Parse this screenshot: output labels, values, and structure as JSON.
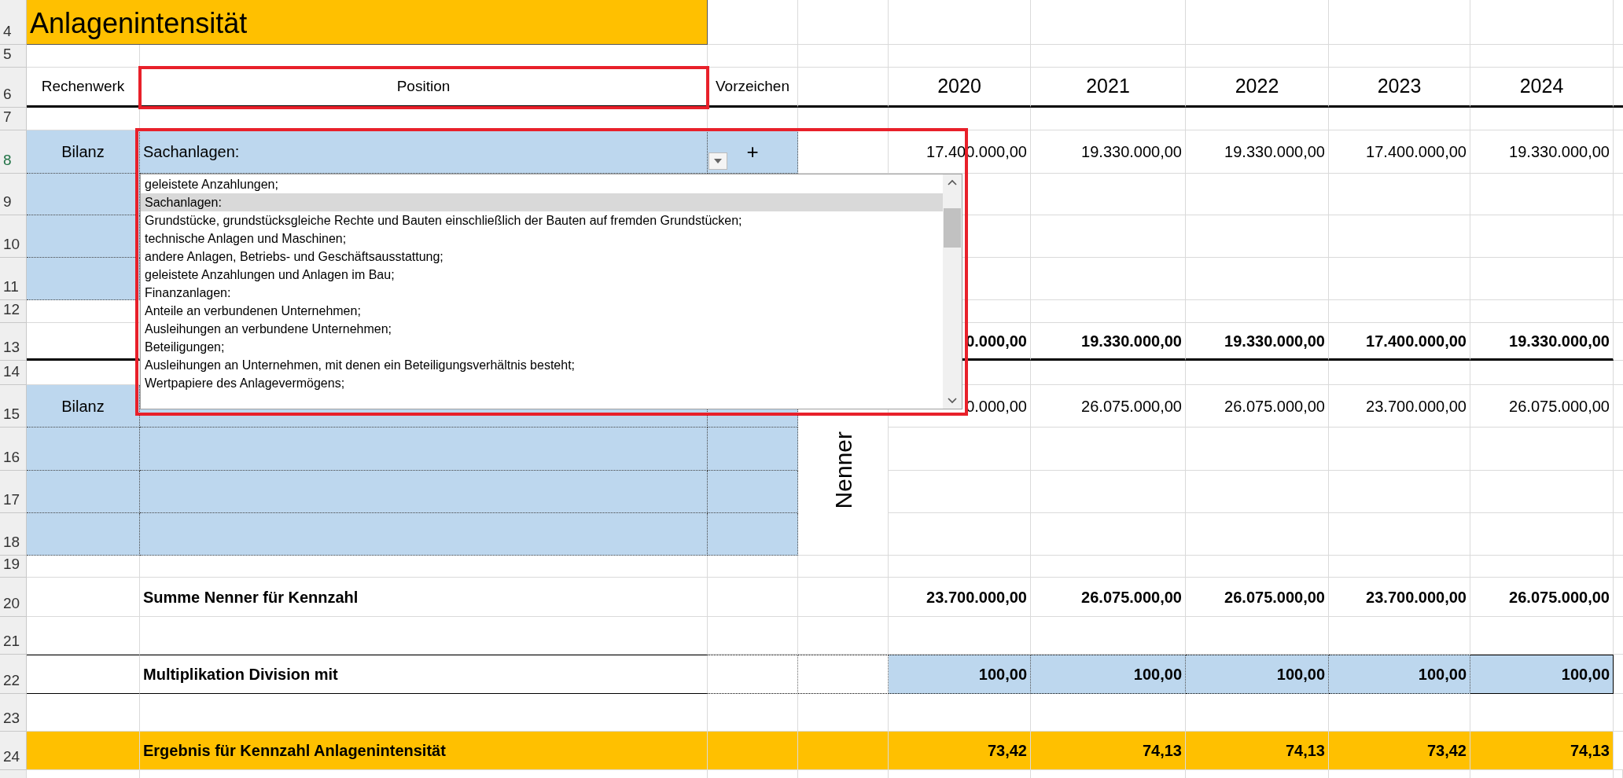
{
  "rows": [
    {
      "number": "4",
      "active": false,
      "kind": "title",
      "title": "Anlagenintensität"
    },
    {
      "number": "5",
      "active": false,
      "kind": "blank"
    },
    {
      "number": "6",
      "active": false,
      "kind": "header",
      "a": "Rechenwerk",
      "b": "Position",
      "c": "Vorzeichen",
      "values": [
        "2020",
        "2021",
        "2022",
        "2023",
        "2024"
      ]
    },
    {
      "number": "7",
      "active": false,
      "kind": "blank"
    },
    {
      "number": "8",
      "active": true,
      "kind": "input",
      "a": "Bilanz",
      "b": "Sachanlagen:",
      "c": "+",
      "values": [
        "17.400.000,00",
        "19.330.000,00",
        "19.330.000,00",
        "17.400.000,00",
        "19.330.000,00"
      ]
    },
    {
      "number": "9",
      "active": false,
      "kind": "input"
    },
    {
      "number": "10",
      "active": false,
      "kind": "input"
    },
    {
      "number": "11",
      "active": false,
      "kind": "input"
    },
    {
      "number": "12",
      "active": false,
      "kind": "blank"
    },
    {
      "number": "13",
      "active": false,
      "kind": "sum",
      "values": [
        "0.000,00",
        "19.330.000,00",
        "19.330.000,00",
        "17.400.000,00",
        "19.330.000,00"
      ]
    },
    {
      "number": "14",
      "active": false,
      "kind": "blank"
    },
    {
      "number": "15",
      "active": false,
      "kind": "input",
      "a": "Bilanz",
      "side_label": "Nenner",
      "values": [
        "0.000,00",
        "26.075.000,00",
        "26.075.000,00",
        "23.700.000,00",
        "26.075.000,00"
      ]
    },
    {
      "number": "16",
      "active": false,
      "kind": "input"
    },
    {
      "number": "17",
      "active": false,
      "kind": "input"
    },
    {
      "number": "18",
      "active": false,
      "kind": "input"
    },
    {
      "number": "19",
      "active": false,
      "kind": "blank"
    },
    {
      "number": "20",
      "active": false,
      "kind": "total",
      "b": "Summe Nenner für Kennzahl",
      "values": [
        "23.700.000,00",
        "26.075.000,00",
        "26.075.000,00",
        "23.700.000,00",
        "26.075.000,00"
      ]
    },
    {
      "number": "21",
      "active": false,
      "kind": "blank"
    },
    {
      "number": "22",
      "active": false,
      "kind": "factor",
      "b": "Multiplikation Division mit",
      "values": [
        "100,00",
        "100,00",
        "100,00",
        "100,00",
        "100,00"
      ]
    },
    {
      "number": "23",
      "active": false,
      "kind": "blank"
    },
    {
      "number": "24",
      "active": false,
      "kind": "result",
      "b": "Ergebnis für Kennzahl Anlagenintensität",
      "values": [
        "73,42",
        "74,13",
        "74,13",
        "73,42",
        "74,13"
      ]
    }
  ],
  "position_header_highlighted": true,
  "dropdown": {
    "highlighted": true,
    "items": [
      {
        "label": "geleistete Anzahlungen;",
        "selected": false
      },
      {
        "label": "Sachanlagen:",
        "selected": true
      },
      {
        "label": "Grundstücke, grundstücksgleiche Rechte und Bauten einschließlich der Bauten auf fremden Grundstücken;",
        "selected": false
      },
      {
        "label": "technische Anlagen und Maschinen;",
        "selected": false
      },
      {
        "label": "andere Anlagen, Betriebs- und Geschäftsausstattung;",
        "selected": false
      },
      {
        "label": "geleistete Anzahlungen und Anlagen im Bau;",
        "selected": false
      },
      {
        "label": "Finanzanlagen:",
        "selected": false
      },
      {
        "label": "Anteile an verbundenen Unternehmen;",
        "selected": false
      },
      {
        "label": "Ausleihungen an verbundene Unternehmen;",
        "selected": false
      },
      {
        "label": "Beteiligungen;",
        "selected": false
      },
      {
        "label": "Ausleihungen an Unternehmen, mit denen ein Beteiligungsverhältnis besteht;",
        "selected": false
      },
      {
        "label": "Wertpapiere des Anlagevermögens;",
        "selected": false
      }
    ]
  }
}
